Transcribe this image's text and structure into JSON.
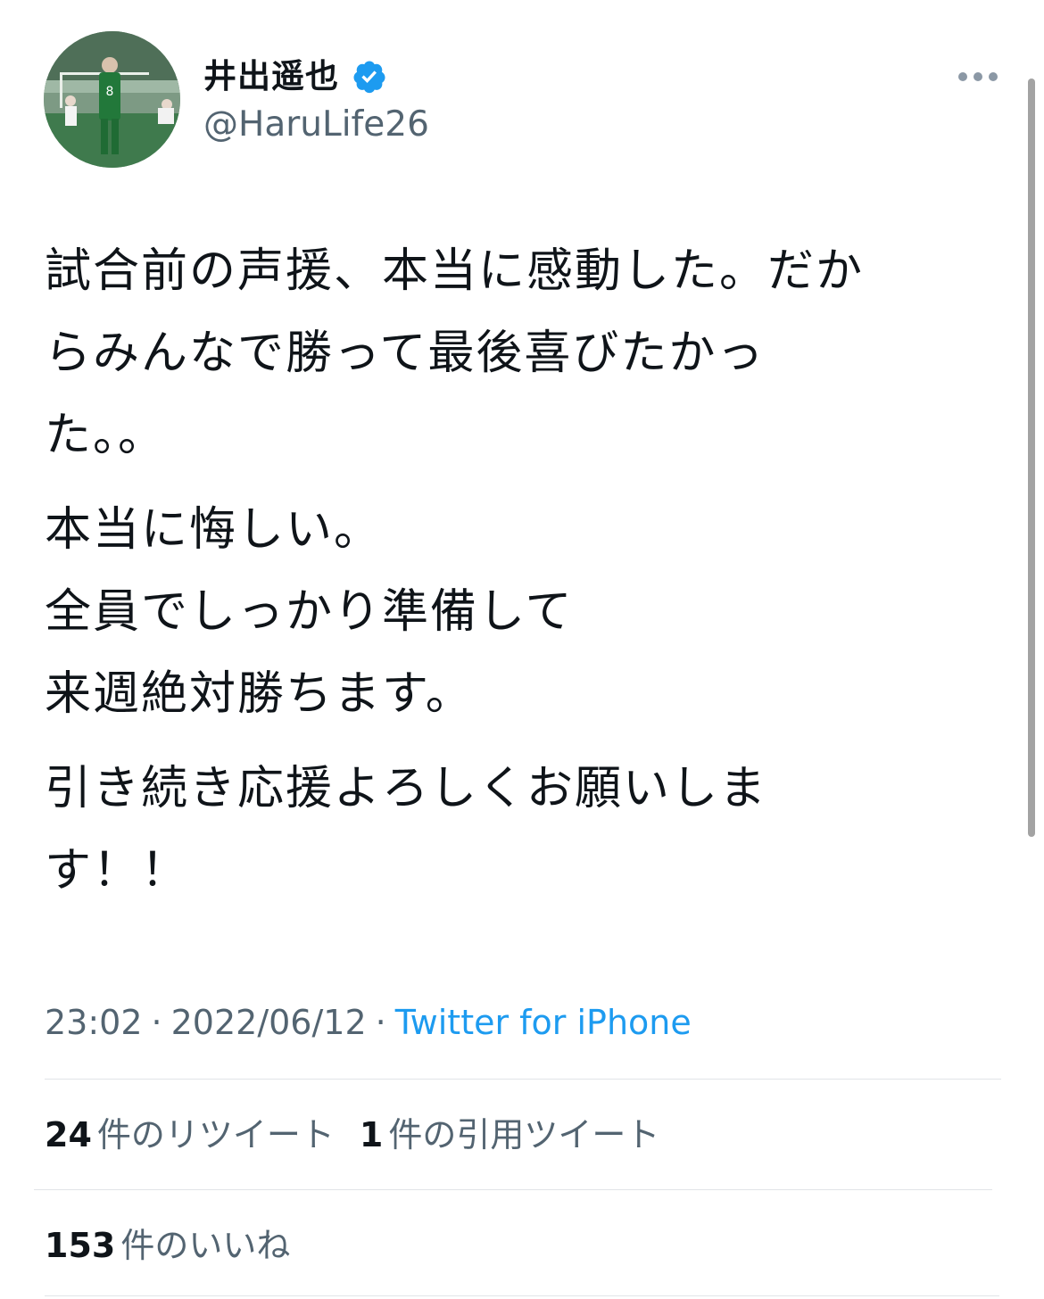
{
  "author": {
    "display_name": "井出遥也",
    "handle": "@HaruLife26",
    "verified": true,
    "avatar_jersey_number": "8"
  },
  "tweet": {
    "paragraphs": [
      [
        "試合前の声援、本当に感動した。だか",
        "らみんなで勝って最後喜びたかっ",
        "た。。"
      ],
      [
        "本当に悔しい。",
        "全員でしっかり準備して",
        "来週絶対勝ちます。"
      ],
      [
        "引き続き応援よろしくお願いしま",
        "す！！"
      ]
    ],
    "time": "23:02",
    "date": "2022/06/12",
    "separator": "·",
    "source": "Twitter for iPhone"
  },
  "stats": {
    "retweets_count": "24",
    "retweets_label": "件のリツイート",
    "quotes_count": "1",
    "quotes_label": "件の引用ツイート",
    "likes_count": "153",
    "likes_label": "件のいいね"
  },
  "colors": {
    "accent": "#1d9bf0",
    "secondary_text": "#536471",
    "primary_text": "#0f1419",
    "divider": "#e1e4e8"
  },
  "icons": {
    "verified": "verified-badge-icon",
    "more": "more-horizontal-icon"
  }
}
